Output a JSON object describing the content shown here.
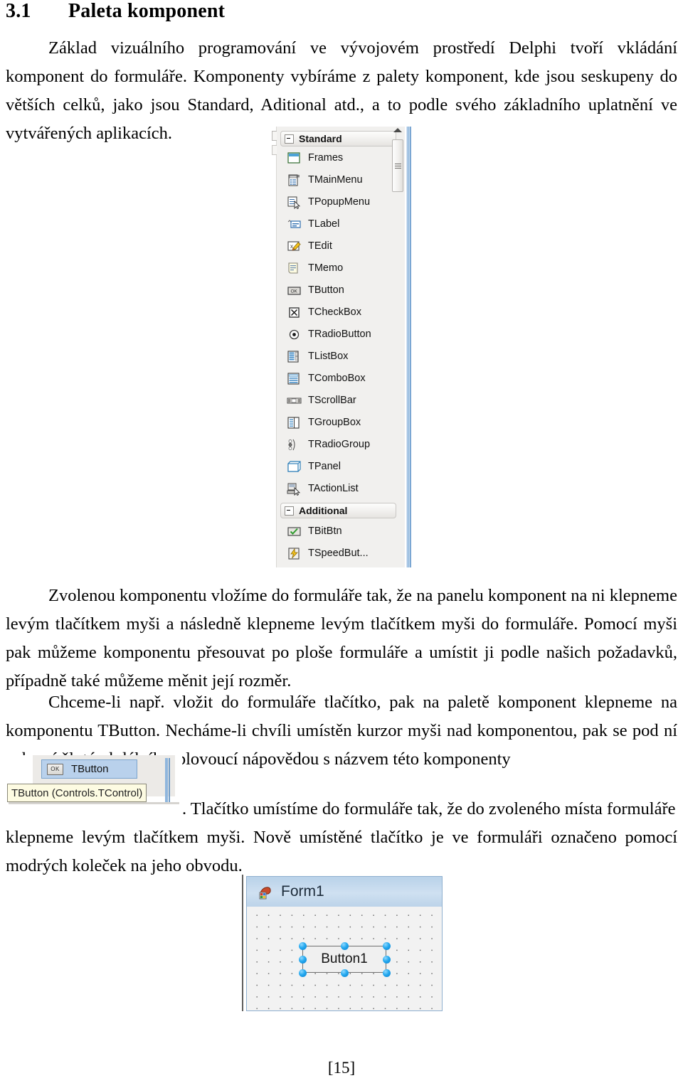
{
  "document": {
    "heading": {
      "number": "3.1",
      "title": "Paleta komponent"
    },
    "paragraphs": [
      "Základ vizuálního programování ve vývojovém prostředí Delphi tvoří vkládání komponent do formuláře. Komponenty vybíráme z palety komponent, kde jsou seskupeny do větších celků, jako jsou Standard, Aditional atd., a to podle svého základního uplatnění ve vytvářených aplikacích.",
      "Zvolenou komponentu vložíme do formuláře tak, že na panelu komponent na ni klepneme levým tlačítkem myši a následně klepneme levým tlačítkem myši do formuláře. Pomocí myši pak můžeme komponentu přesouvat po ploše formuláře a umístit ji podle našich požadavků, případně také můžeme měnit její rozměr.",
      "Chceme-li např. vložit do formuláře tlačítko, pak na paletě komponent klepneme na komponentu TButton. Necháme-li chvíli umístěn kurzor myši nad komponentou, pak se pod ní zobrazí žlutý obdélník s plovoucí nápovědou s názvem této komponenty",
      ". Tlačítko umístíme do formuláře tak, že do zvoleného místa formuláře klepneme levým tlačítkem myši. Nově umístěné tlačítko je ve formuláři označeno pomocí modrých koleček na jeho obvodu."
    ],
    "page_number": "[15]"
  },
  "palette": {
    "groups": [
      {
        "label": "Standard",
        "expander": "collapse-minus"
      },
      {
        "label": "Additional",
        "expander": "collapse-minus"
      }
    ],
    "standard_items": [
      {
        "label": "Frames",
        "icon": "frames-icon"
      },
      {
        "label": "TMainMenu",
        "icon": "mainmenu-icon"
      },
      {
        "label": "TPopupMenu",
        "icon": "popupmenu-icon"
      },
      {
        "label": "TLabel",
        "icon": "label-icon"
      },
      {
        "label": "TEdit",
        "icon": "edit-icon"
      },
      {
        "label": "TMemo",
        "icon": "memo-icon"
      },
      {
        "label": "TButton",
        "icon": "button-icon"
      },
      {
        "label": "TCheckBox",
        "icon": "checkbox-icon"
      },
      {
        "label": "TRadioButton",
        "icon": "radiobutton-icon"
      },
      {
        "label": "TListBox",
        "icon": "listbox-icon"
      },
      {
        "label": "TComboBox",
        "icon": "combobox-icon"
      },
      {
        "label": "TScrollBar",
        "icon": "scrollbar-icon"
      },
      {
        "label": "TGroupBox",
        "icon": "groupbox-icon"
      },
      {
        "label": "TRadioGroup",
        "icon": "radiogroup-icon"
      },
      {
        "label": "TPanel",
        "icon": "panel-icon"
      },
      {
        "label": "TActionList",
        "icon": "actionlist-icon"
      }
    ],
    "additional_items": [
      {
        "label": "TBitBtn",
        "icon": "bitbtn-icon"
      },
      {
        "label": "TSpeedBut...",
        "icon": "speedbutton-icon"
      }
    ],
    "scrollbar": {
      "up_arrow": "scroll-up-arrow",
      "thumb_grip": "grip-lines"
    }
  },
  "tooltip_shot": {
    "selected_item_label": "TButton",
    "selected_item_icon_text": "OK",
    "tooltip_text": "TButton (Controls.TControl)"
  },
  "form_shot": {
    "title": "Form1",
    "title_icon": "delphi-form-icon",
    "button_caption": "Button1",
    "handle_count": 8
  },
  "colors": {
    "palette_group_bg": "#f2f1ef",
    "palette_bg": "#f1f0ee",
    "selection_blue": "#b9d1ec",
    "tooltip_yellow": "#fdfbe2",
    "form_title_blue": "#c3d8ee",
    "handle_blue": "#24a9ef"
  }
}
